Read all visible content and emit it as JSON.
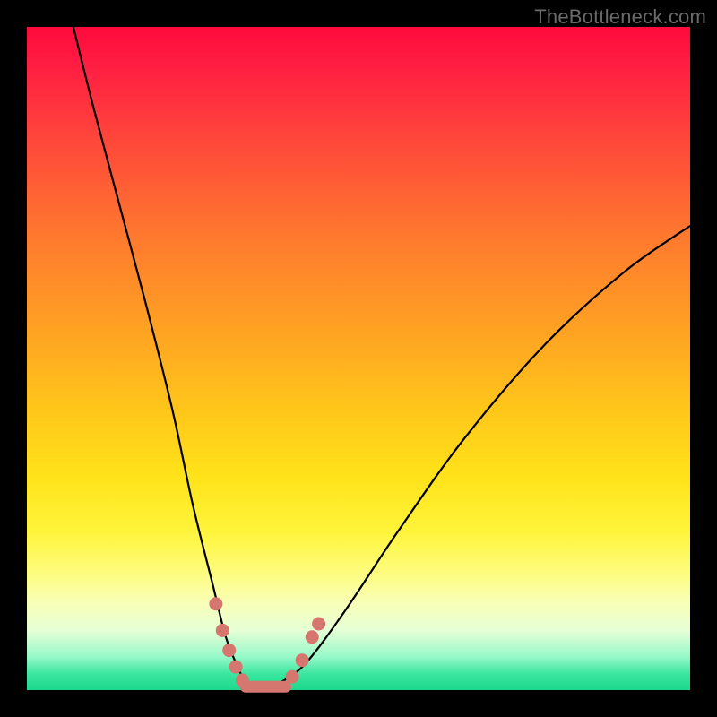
{
  "watermark": "TheBottleneck.com",
  "chart_data": {
    "type": "line",
    "title": "",
    "xlabel": "",
    "ylabel": "",
    "xlim": [
      0,
      100
    ],
    "ylim": [
      0,
      100
    ],
    "series": [
      {
        "name": "bottleneck-curve",
        "x": [
          7,
          10,
          14,
          18,
          22,
          25,
          28,
          30,
          32,
          33,
          34,
          35,
          36,
          38,
          42,
          48,
          56,
          66,
          78,
          90,
          100
        ],
        "y": [
          100,
          88,
          73,
          58,
          42,
          28,
          16,
          8,
          3,
          1,
          0,
          0,
          0,
          1,
          4,
          12,
          24,
          38,
          52,
          63,
          70
        ]
      }
    ],
    "markers": {
      "name": "highlight-dots",
      "points": [
        {
          "x": 28.5,
          "y": 13
        },
        {
          "x": 29.5,
          "y": 9
        },
        {
          "x": 30.5,
          "y": 6
        },
        {
          "x": 31.5,
          "y": 3.5
        },
        {
          "x": 32.5,
          "y": 1.5
        },
        {
          "x": 40.0,
          "y": 2
        },
        {
          "x": 41.5,
          "y": 4.5
        },
        {
          "x": 43.0,
          "y": 8
        },
        {
          "x": 44.0,
          "y": 10
        }
      ],
      "plateau": {
        "x0": 33,
        "x1": 39,
        "y": 0.5
      }
    },
    "background_gradient": {
      "top": "#ff0a3c",
      "mid": "#ffe31a",
      "bottom": "#1cd88c"
    }
  }
}
